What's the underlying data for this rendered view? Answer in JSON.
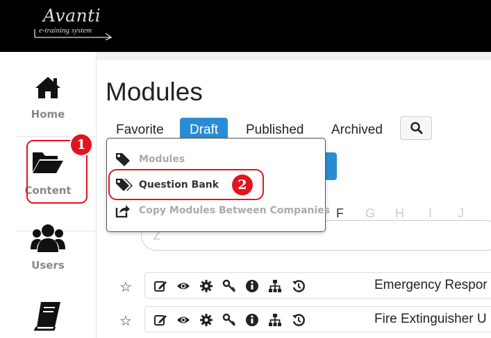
{
  "app": {
    "brand": "Avanti",
    "tagline": "e-training system"
  },
  "sidebar": {
    "items": [
      {
        "label": "Home",
        "icon": "home-icon"
      },
      {
        "label": "Content",
        "icon": "folder-open-icon"
      },
      {
        "label": "Users",
        "icon": "users-icon"
      },
      {
        "label": "",
        "icon": "book-icon"
      }
    ]
  },
  "main": {
    "title": "Modules",
    "tabs": [
      {
        "label": "Favorite"
      },
      {
        "label": "Draft",
        "active": true
      },
      {
        "label": "Published"
      },
      {
        "label": "Archived"
      }
    ],
    "letters": [
      "F",
      "G",
      "H",
      "I",
      "J"
    ],
    "filter_placeholder": "Z"
  },
  "dropdown": {
    "items": [
      {
        "label": "Modules",
        "icon": "tag-icon"
      },
      {
        "label": "Question Bank",
        "icon": "tags-icon"
      },
      {
        "label": "Copy Modules Between Companies",
        "icon": "share-square-icon"
      }
    ]
  },
  "callouts": {
    "step1": "1",
    "step2": "2"
  },
  "modules": [
    {
      "title": "Emergency Respor"
    },
    {
      "title": "Fire Extinguisher U"
    }
  ],
  "colors": {
    "accent": "#2a8dd4",
    "callout": "#e0141e",
    "topbar": "#000000"
  }
}
